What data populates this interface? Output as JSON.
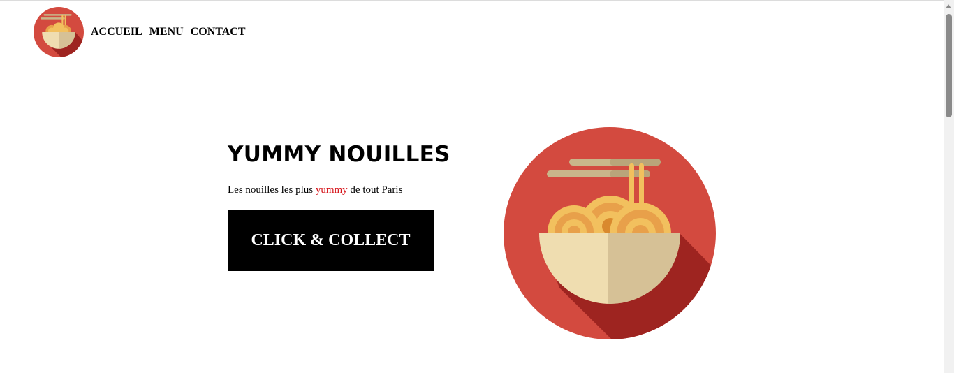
{
  "brand": {
    "logo_icon": "noodle-bowl-icon",
    "colors": {
      "red": "#d34a3f",
      "shadow": "#9e2420",
      "bowl_light": "#efddb0",
      "bowl_dark": "#d6c196",
      "noodle": "#f2c05e",
      "noodle_dark": "#e8a04a",
      "chopstick": "#c9b68a",
      "accent": "#d6141a"
    }
  },
  "nav": {
    "items": [
      {
        "label": "ACCUEIL",
        "active": true
      },
      {
        "label": "MENU",
        "active": false
      },
      {
        "label": "CONTACT",
        "active": false
      }
    ]
  },
  "hero": {
    "title": "YUMMY NOUILLES",
    "tagline_before": "Les nouilles les plus ",
    "tagline_accent": "yummy",
    "tagline_after": " de tout Paris",
    "cta_label": "CLICK & COLLECT",
    "image_icon": "noodle-bowl-icon"
  },
  "scrollbar": {
    "icon": "scroll-up-arrow-icon"
  }
}
